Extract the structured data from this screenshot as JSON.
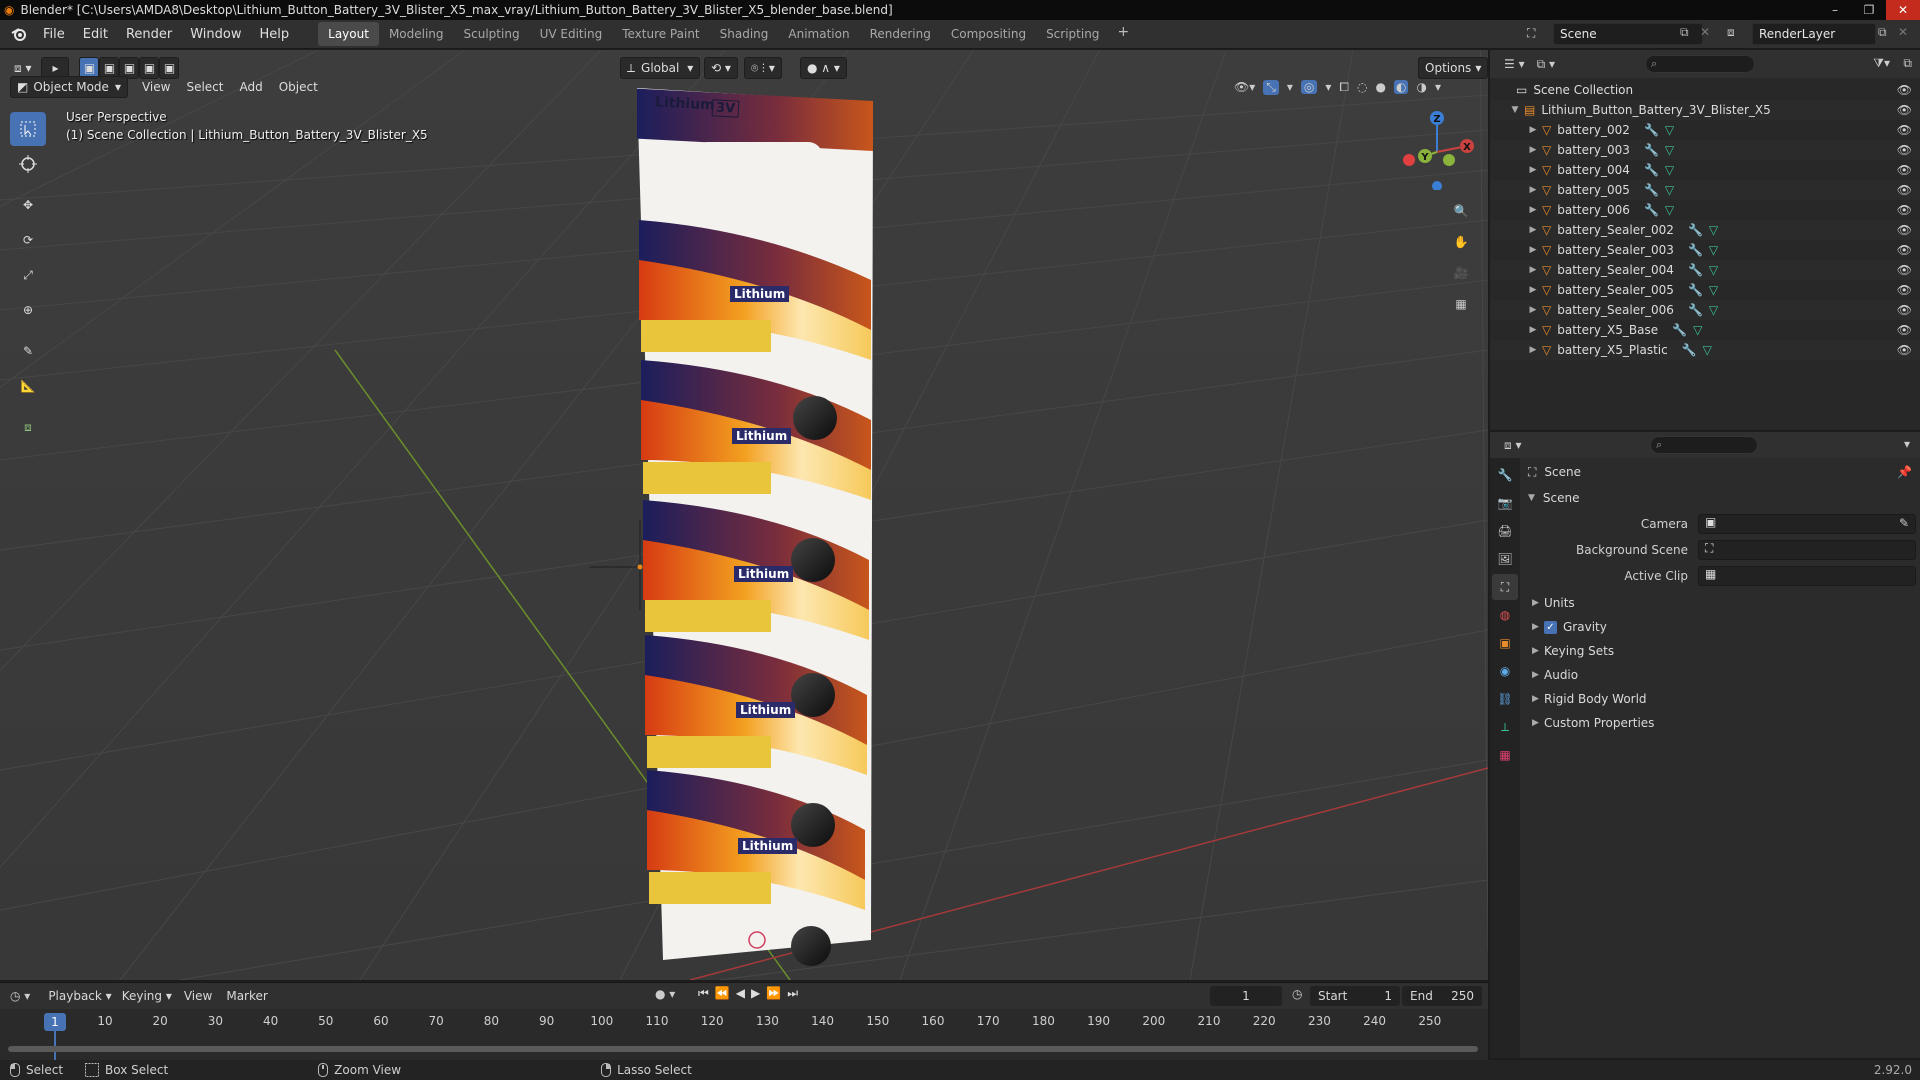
{
  "window": {
    "title": "Blender* [C:\\Users\\AMDA8\\Desktop\\Lithium_Button_Battery_3V_Blister_X5_max_vray/Lithium_Button_Battery_3V_Blister_X5_blender_base.blend]",
    "minimize": "–",
    "maximize": "❐",
    "close": "✕"
  },
  "menu": [
    "File",
    "Edit",
    "Render",
    "Window",
    "Help"
  ],
  "workspaces": [
    "Layout",
    "Modeling",
    "Sculpting",
    "UV Editing",
    "Texture Paint",
    "Shading",
    "Animation",
    "Rendering",
    "Compositing",
    "Scripting",
    "+"
  ],
  "scene_selector": {
    "scene": "Scene",
    "view_layer": "RenderLayer"
  },
  "viewport": {
    "mode": "Object Mode",
    "menus": [
      "View",
      "Select",
      "Add",
      "Object"
    ],
    "transform_orientation": "Global",
    "options": "Options",
    "info_line1": "User Perspective",
    "info_line2": "(1) Scene Collection | Lithium_Button_Battery_3V_Blister_X5",
    "gizmo": {
      "x": "X",
      "y": "Y",
      "z": "Z"
    }
  },
  "package": {
    "brand": "Lithium",
    "voltage": "3V"
  },
  "outliner": {
    "root": "Scene Collection",
    "collection": "Lithium_Button_Battery_3V_Blister_X5",
    "objects": [
      "battery_002",
      "battery_003",
      "battery_004",
      "battery_005",
      "battery_006",
      "battery_Sealer_002",
      "battery_Sealer_003",
      "battery_Sealer_004",
      "battery_Sealer_005",
      "battery_Sealer_006",
      "battery_X5_Base",
      "battery_X5_Plastic"
    ]
  },
  "properties": {
    "context": "Scene",
    "panel": "Scene",
    "fields": [
      {
        "label": "Camera",
        "value": ""
      },
      {
        "label": "Background Scene",
        "value": ""
      },
      {
        "label": "Active Clip",
        "value": ""
      }
    ],
    "subpanels": [
      "Units",
      "Gravity",
      "Keying Sets",
      "Audio",
      "Rigid Body World",
      "Custom Properties"
    ],
    "gravity_checked": true
  },
  "timeline": {
    "menus": [
      "Playback",
      "Keying",
      "View",
      "Marker"
    ],
    "current_frame": "1",
    "start_label": "Start",
    "start": "1",
    "end_label": "End",
    "end": "250",
    "ticks": [
      "10",
      "20",
      "30",
      "40",
      "50",
      "60",
      "70",
      "80",
      "90",
      "100",
      "110",
      "120",
      "130",
      "140",
      "150",
      "160",
      "170",
      "180",
      "190",
      "200",
      "210",
      "220",
      "230",
      "240",
      "250"
    ],
    "cursor_label": "1"
  },
  "statusbar": {
    "select": "Select",
    "box_select": "Box Select",
    "zoom_view": "Zoom View",
    "lasso_select": "Lasso Select",
    "version": "2.92.0"
  },
  "colors": {
    "accent": "#4772b3",
    "x_axis": "#c9423f",
    "y_axis": "#8ab33c",
    "z_axis": "#3a7fd5",
    "mesh_icon": "#e98c2b",
    "modifier_icon": "#5fa8e6",
    "data_icon": "#3bc09a"
  }
}
